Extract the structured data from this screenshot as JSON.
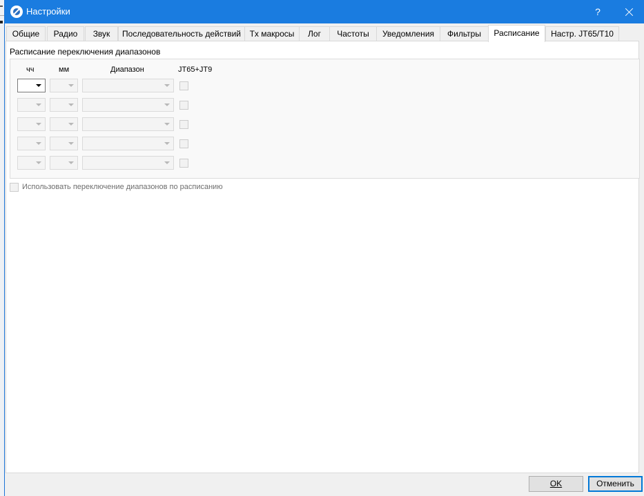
{
  "window": {
    "title": "Настройки",
    "help_label": "?"
  },
  "tabs": [
    {
      "label": "Общие",
      "active": false
    },
    {
      "label": "Радио",
      "active": false
    },
    {
      "label": "Звук",
      "active": false
    },
    {
      "label": "Последовательность действий",
      "active": false
    },
    {
      "label": "Tx макросы",
      "active": false
    },
    {
      "label": "Лог",
      "active": false
    },
    {
      "label": "Частоты",
      "active": false
    },
    {
      "label": "Уведомления",
      "active": false
    },
    {
      "label": "Фильтры",
      "active": false
    },
    {
      "label": "Расписание",
      "active": true
    },
    {
      "label": "Настр. JT65/T10",
      "active": false
    }
  ],
  "schedule": {
    "group_title": "Расписание переключения диапазонов",
    "columns": {
      "hour": "чч",
      "minute": "мм",
      "band": "Диапазон",
      "jt65jt9": "JT65+JT9"
    },
    "rows": [
      {
        "hour": "",
        "minute": "",
        "band": "",
        "jt65jt9": false
      },
      {
        "hour": "",
        "minute": "",
        "band": "",
        "jt65jt9": false
      },
      {
        "hour": "",
        "minute": "",
        "band": "",
        "jt65jt9": false
      },
      {
        "hour": "",
        "minute": "",
        "band": "",
        "jt65jt9": false
      },
      {
        "hour": "",
        "minute": "",
        "band": "",
        "jt65jt9": false
      }
    ],
    "use_schedule_label": "Использовать переключение диапазонов по  расписанию",
    "use_schedule_checked": false
  },
  "buttons": {
    "ok": "OK",
    "cancel": "Отменить"
  }
}
